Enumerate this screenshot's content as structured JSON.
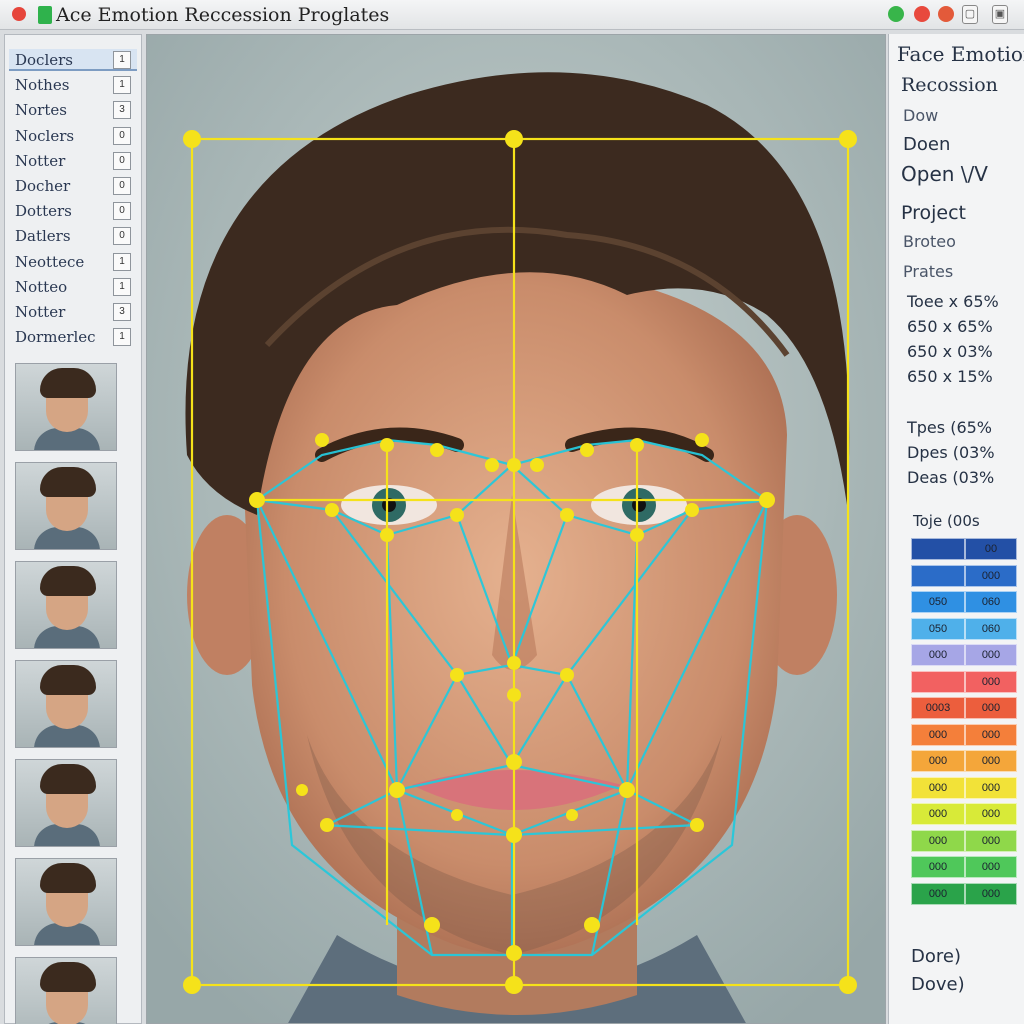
{
  "window": {
    "title": "Ace Emotion Reccession Proglates",
    "colors": {
      "accent_yellow": "#f5e21a",
      "mesh_cyan": "#25c9dc",
      "selection": "#d8e4f2"
    }
  },
  "sidebar": {
    "items": [
      {
        "label": "Doclers",
        "check": "1"
      },
      {
        "label": "Nothes",
        "check": "1"
      },
      {
        "label": "Nortes",
        "check": "3"
      },
      {
        "label": "Noclers",
        "check": "0"
      },
      {
        "label": "Notter",
        "check": "0"
      },
      {
        "label": "Docher",
        "check": "0"
      },
      {
        "label": "Dotters",
        "check": "0"
      },
      {
        "label": "Datlers",
        "check": "0"
      },
      {
        "label": "Neottece",
        "check": "1"
      },
      {
        "label": "Notteo",
        "check": "1"
      },
      {
        "label": "Notter",
        "check": "3"
      },
      {
        "label": "Dormerlec",
        "check": "1"
      }
    ],
    "thumbnails": [
      "face-thumb",
      "face-thumb",
      "face-thumb",
      "face-thumb",
      "face-thumb",
      "face-thumb",
      "face-thumb"
    ]
  },
  "right_panel": {
    "heading_1": "Face Emotior",
    "heading_2": "Recossion",
    "sub_1": "Dow",
    "sub_2": "Doen",
    "sub_3": "Open \\/V",
    "project": "Project",
    "line_a": "Broteo",
    "line_b": "Prates",
    "stats_1": [
      "Toee x 65%",
      "650 x 65%",
      "650 x 03%",
      "650 x 15%"
    ],
    "stats_2": [
      "Tpes (65%",
      "Dpes (03%",
      "Deas (03%"
    ],
    "table_header": "Toje (00s",
    "scores": [
      {
        "left": "",
        "right": "00",
        "color": "#2350a6"
      },
      {
        "left": "",
        "right": "000",
        "color": "#2b6cc8"
      },
      {
        "left": "050",
        "right": "060",
        "color": "#2f90e3"
      },
      {
        "left": "050",
        "right": "060",
        "color": "#4fb0ea"
      },
      {
        "left": "000",
        "right": "000",
        "color": "#a6a6e6"
      },
      {
        "left": "",
        "right": "000",
        "color": "#f26161"
      },
      {
        "left": "0003",
        "right": "000",
        "color": "#ec5e3d"
      },
      {
        "left": "000",
        "right": "000",
        "color": "#f47f3a"
      },
      {
        "left": "000",
        "right": "000",
        "color": "#f4a63a"
      },
      {
        "left": "000",
        "right": "000",
        "color": "#f2e238"
      },
      {
        "left": "000",
        "right": "000",
        "color": "#d8ea38"
      },
      {
        "left": "000",
        "right": "000",
        "color": "#8fd84a"
      },
      {
        "left": "000",
        "right": "000",
        "color": "#4fc85a"
      },
      {
        "left": "000",
        "right": "000",
        "color": "#2aa34a"
      }
    ],
    "footer_1": "Dore)",
    "footer_2": "Dove)"
  }
}
